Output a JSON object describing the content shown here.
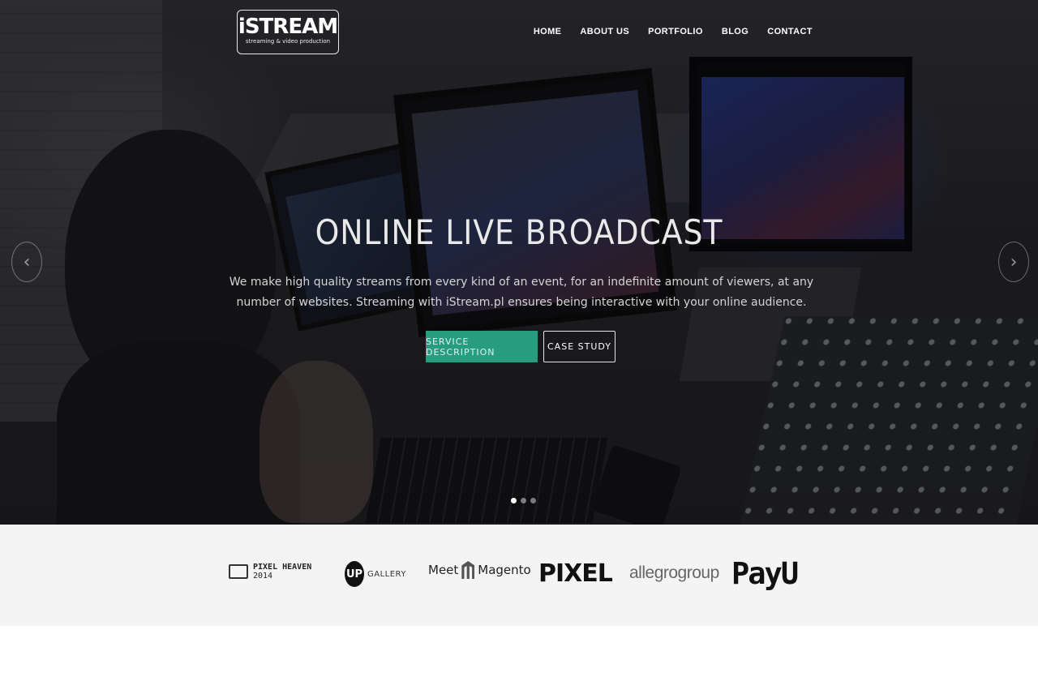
{
  "brand": {
    "name": "iSTREAM",
    "tagline": "streaming & video production"
  },
  "nav": {
    "items": [
      "HOME",
      "ABOUT US",
      "PORTFOLIO",
      "BLOG",
      "CONTACT"
    ]
  },
  "hero": {
    "title": "ONLINE LIVE BROADCAST",
    "subtitle": "We make high quality streams from every kind of an event, for an indefinite amount of viewers, at any number of websites. Streaming with iStream.pl ensures being interactive with your online audience.",
    "primary_button": "SERVICE DESCRIPTION",
    "secondary_button": "CASE STUDY",
    "prev_arrow": "‹",
    "next_arrow": "›",
    "slides_total": 3,
    "slide_active": 1,
    "accent_color": "#279c80"
  },
  "clients": {
    "pixelheaven_line1": "PIXEL HEAVEN",
    "pixelheaven_line2": "2014",
    "up_logo": "UP",
    "up_text": "GALLERY",
    "magento_meet": "Meet",
    "magento_name": "Magento",
    "pixel": "PIXEL",
    "allegro": "allegrogroup",
    "payu": "PayU"
  }
}
